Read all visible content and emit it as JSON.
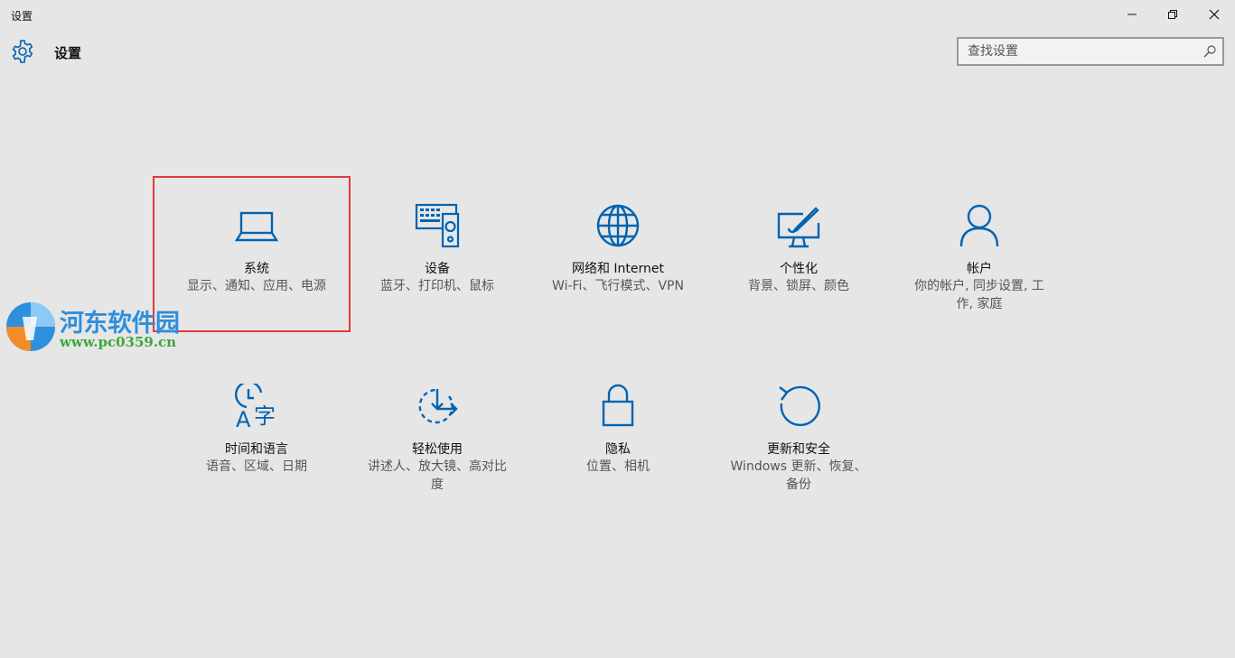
{
  "window": {
    "title": "设置",
    "controls": {
      "minimize": "minimize",
      "maximize": "restore",
      "close": "close"
    }
  },
  "header": {
    "title": "设置",
    "search_placeholder": "查找设置"
  },
  "accent_color": "#0063b1",
  "highlight_color": "#e33a3a",
  "tiles": [
    {
      "icon": "laptop-icon",
      "label": "系统",
      "desc": "显示、通知、应用、电源"
    },
    {
      "icon": "devices-icon",
      "label": "设备",
      "desc": "蓝牙、打印机、鼠标"
    },
    {
      "icon": "globe-icon",
      "label": "网络和 Internet",
      "desc": "Wi-Fi、飞行模式、VPN"
    },
    {
      "icon": "personalization-icon",
      "label": "个性化",
      "desc": "背景、锁屏、颜色"
    },
    {
      "icon": "person-icon",
      "label": "帐户",
      "desc": "你的帐户, 同步设置, 工作, 家庭"
    },
    {
      "icon": "time-language-icon",
      "label": "时间和语言",
      "desc": "语音、区域、日期"
    },
    {
      "icon": "ease-of-access-icon",
      "label": "轻松使用",
      "desc": "讲述人、放大镜、高对比度"
    },
    {
      "icon": "lock-icon",
      "label": "隐私",
      "desc": "位置、相机"
    },
    {
      "icon": "update-icon",
      "label": "更新和安全",
      "desc": "Windows 更新、恢复、备份"
    }
  ],
  "watermark": {
    "name": "河东软件园",
    "url": "www.pc0359.cn"
  }
}
